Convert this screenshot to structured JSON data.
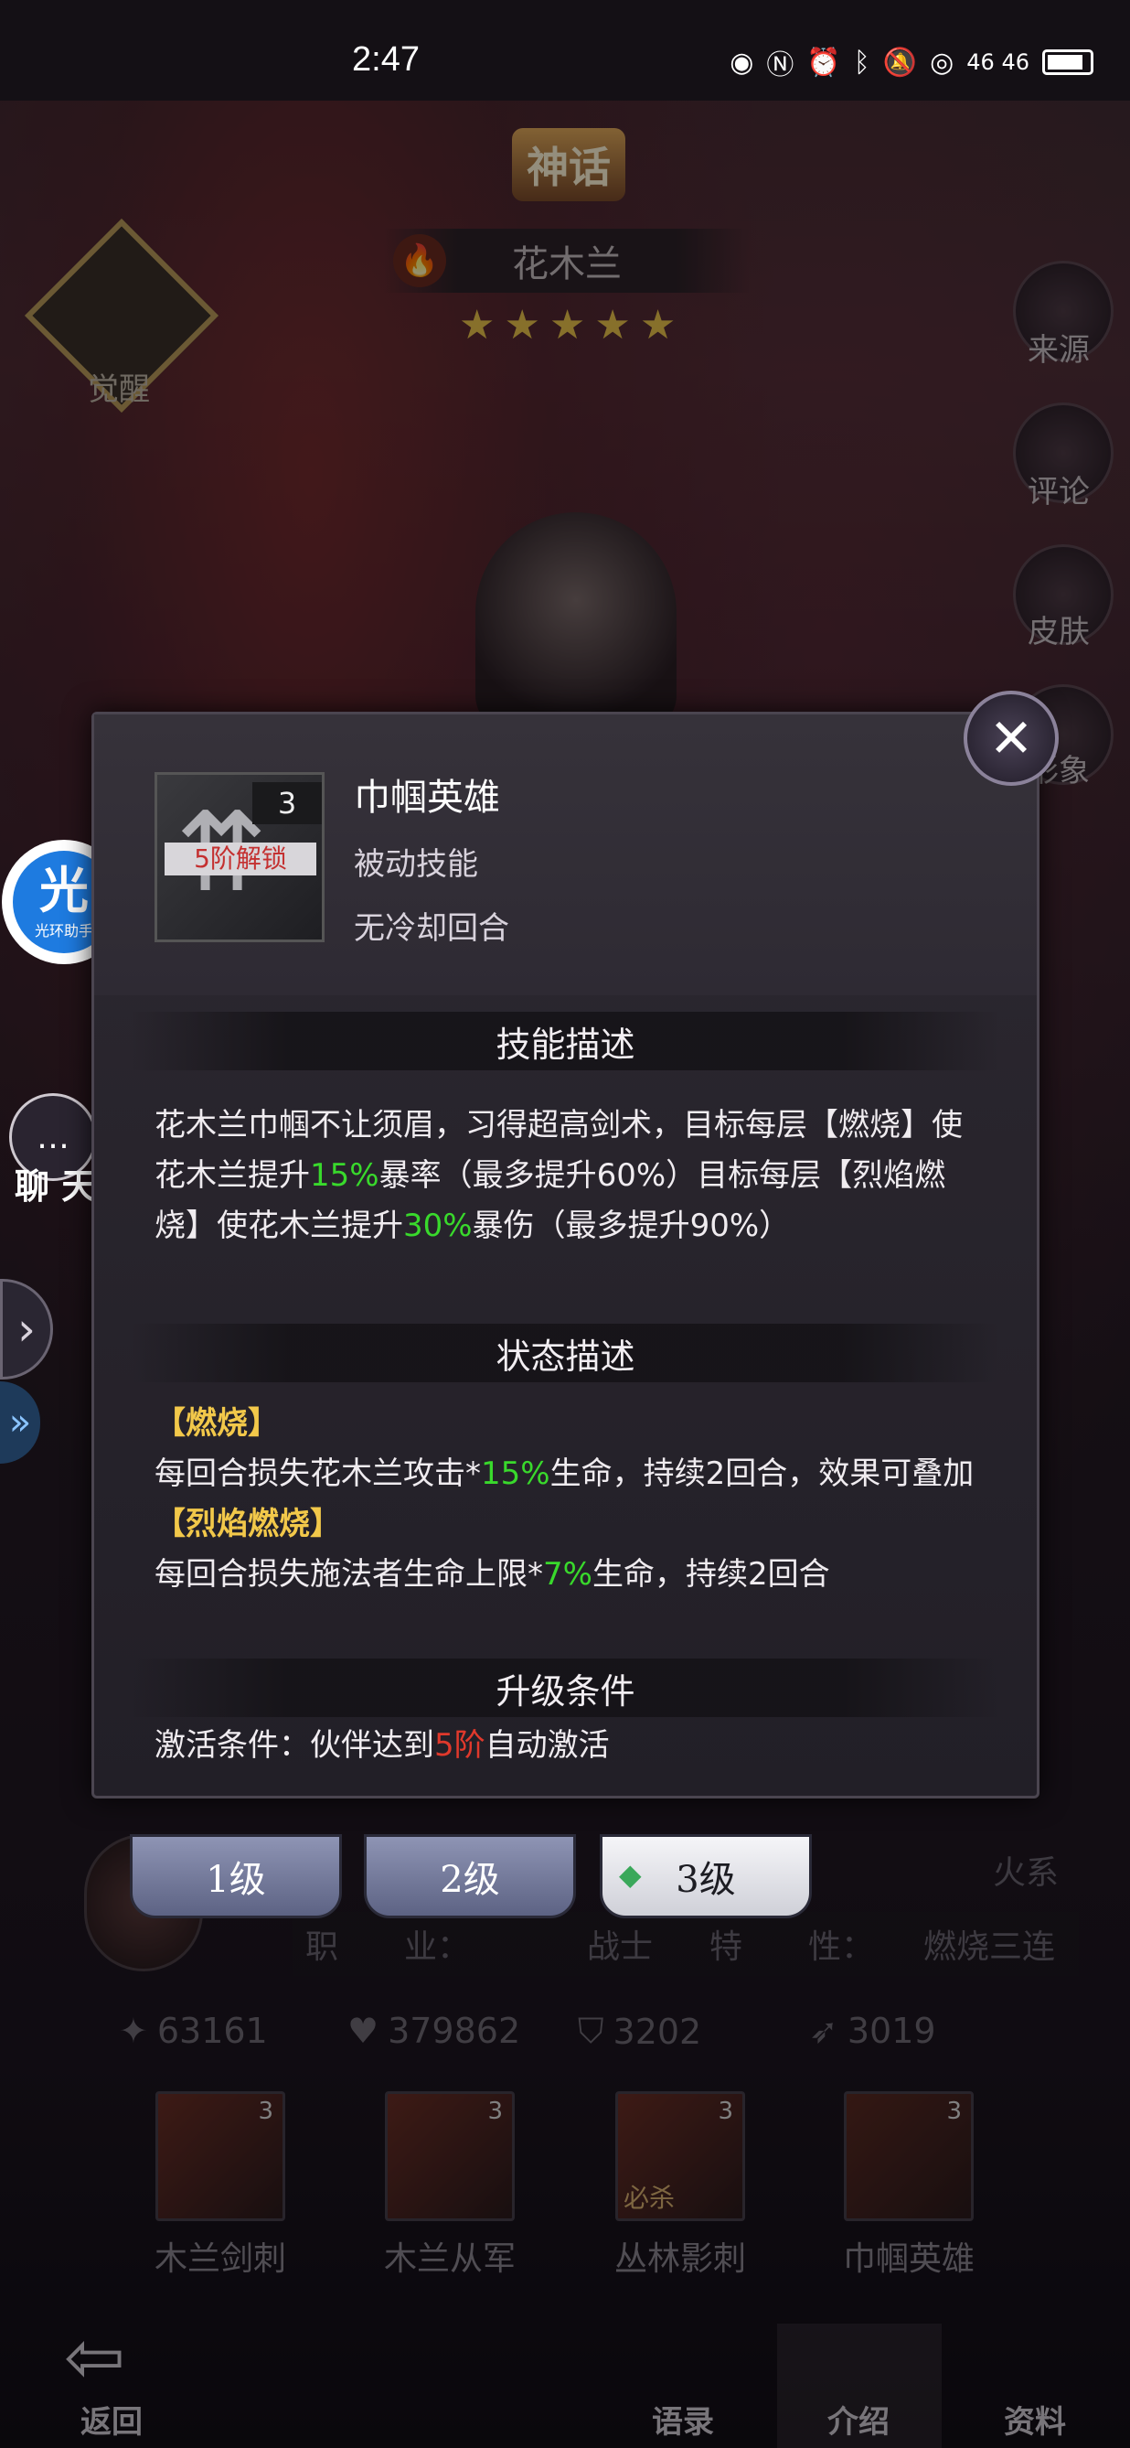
{
  "status_bar": {
    "time": "2:47",
    "icons_text": "46 46"
  },
  "hero": {
    "rarity_badge": "神话",
    "name": "花木兰",
    "stars": 5
  },
  "left_panel": {
    "awaken_label": "觉醒",
    "helper_label": "光环助手",
    "helper_glyph": "光",
    "chat_label": "聊 天"
  },
  "right_menu": {
    "source": "来源",
    "comment": "评论",
    "skin": "皮肤",
    "image": "形象"
  },
  "popup": {
    "skill_name": "巾帼英雄",
    "skill_type": "被动技能",
    "cooldown": "无冷却回合",
    "thumb_level": "3",
    "unlock_tag": "5阶解锁",
    "section_skill": "技能描述",
    "skill_desc_parts": [
      "花木兰巾帼不让须眉，习得超高剑术，目标每层【燃烧】使花木兰提升",
      "15%",
      "暴率（最多提升60%）目标每层【烈焰燃烧】使花木兰提升",
      "30%",
      "暴伤（最多提升90%）"
    ],
    "section_status": "状态描述",
    "status1_title": "【燃烧】",
    "status1_parts": [
      "每回合损失花木兰攻击*",
      "15%",
      "生命，持续2回合，效果可叠加"
    ],
    "status2_title": "【烈焰燃烧】",
    "status2_parts": [
      "每回合损失施法者生命上限*",
      "7%",
      "生命，持续2回合"
    ],
    "section_upgrade": "升级条件",
    "upgrade_parts": [
      "激活条件：伙伴达到",
      "5阶",
      "自动激活"
    ]
  },
  "level_tabs": [
    {
      "label": "1级"
    },
    {
      "label": "2级"
    },
    {
      "label": "3级"
    }
  ],
  "attributes": {
    "element_value": "火系",
    "job_label": "职　　业：",
    "job_value": "战士",
    "trait_label": "特　　性：",
    "trait_value": "燃烧三连"
  },
  "stats": {
    "attack": "63161",
    "hp": "379862",
    "defense": "3202",
    "speed": "3019"
  },
  "skills": [
    {
      "name": "木兰剑刺",
      "level": "3"
    },
    {
      "name": "木兰从军",
      "level": "3"
    },
    {
      "name": "丛林影刺",
      "level": "3",
      "tag": "必杀"
    },
    {
      "name": "巾帼英雄",
      "level": "3"
    }
  ],
  "bottom_nav": {
    "back": "返回",
    "quotes": "语录",
    "intro": "介绍",
    "info": "资料"
  },
  "colors": {
    "highlight_green": "#39d92c",
    "highlight_red": "#e0392c",
    "status_gold": "#f2c84a"
  }
}
